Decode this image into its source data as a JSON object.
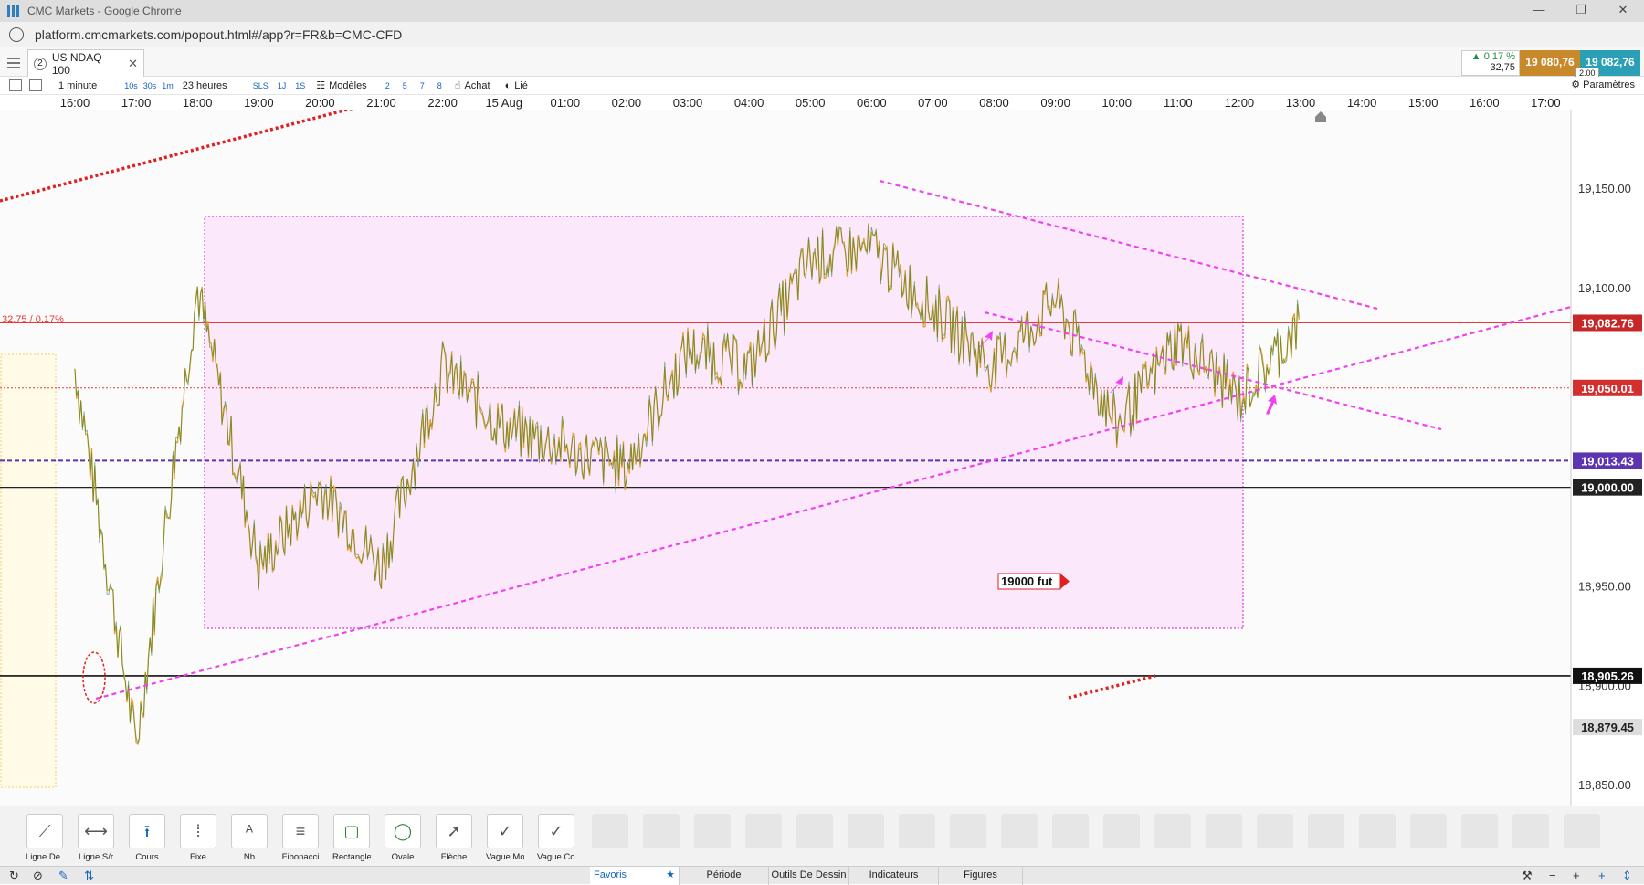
{
  "window": {
    "title": "CMC Markets - Google Chrome",
    "controls": [
      "—",
      "❐",
      "✕"
    ]
  },
  "browser": {
    "url": "platform.cmcmarkets.com/popout.html#/app?r=FR&b=CMC-CFD"
  },
  "instrument": {
    "tab_number": "2",
    "name": "US NDAQ 100",
    "change_pct": "▲ 0,17 %",
    "change_abs": "32,75",
    "sell": "19 080,76",
    "buy": "19 082,76",
    "spread": "2.00"
  },
  "toolbar": {
    "interval": "1 minute",
    "interval_buttons": [
      "10s",
      "30s",
      "1m"
    ],
    "range": "23 heures",
    "range_buttons": [
      "SLS",
      "1J",
      "1S"
    ],
    "templates": "Modèles",
    "template_buttons": [
      "2",
      "5",
      "7",
      "8"
    ],
    "buy_label": "Achat",
    "linked_label": "Lié",
    "settings_label": "Paramètres"
  },
  "time_axis": [
    "16:00",
    "17:00",
    "18:00",
    "19:00",
    "20:00",
    "21:00",
    "22:00",
    "15 Aug",
    "01:00",
    "02:00",
    "03:00",
    "04:00",
    "05:00",
    "06:00",
    "07:00",
    "08:00",
    "09:00",
    "10:00",
    "11:00",
    "12:00",
    "13:00",
    "14:00",
    "15:00",
    "16:00",
    "17:00"
  ],
  "chart_data": {
    "type": "line",
    "ylim": [
      18840,
      19190
    ],
    "y_ticks": [
      "19,150.00",
      "19,100.00",
      "18,950.00",
      "18,900.00",
      "18,850.00"
    ],
    "price_tags": [
      {
        "label": "19,082.76",
        "value": 19082.76,
        "color": "#c62828"
      },
      {
        "label": "19,050.01",
        "value": 19050.01,
        "color": "#d32f2f"
      },
      {
        "label": "19,013.43",
        "value": 19013.43,
        "color": "#5e35b1"
      },
      {
        "label": "19,000.00",
        "value": 19000.0,
        "color": "#222222"
      },
      {
        "label": "18,905.26",
        "value": 18905.26,
        "color": "#111111"
      },
      {
        "label": "18,879.45",
        "value": 18879.45,
        "color": "#dddddd"
      }
    ],
    "change_label": "32.75 / 0.17%",
    "annotation_label": "19000 fut",
    "x": [
      "16:00",
      "17:00",
      "18:00",
      "19:00",
      "20:00",
      "21:00",
      "22:00",
      "15 Aug",
      "01:00",
      "02:00",
      "03:00",
      "04:00",
      "05:00",
      "06:00",
      "07:00",
      "08:00",
      "09:00",
      "10:00",
      "11:00",
      "12:00",
      "13:00"
    ],
    "values": [
      19060,
      18870,
      19100,
      18960,
      19000,
      18960,
      19060,
      19030,
      19020,
      19010,
      19070,
      19060,
      19115,
      19120,
      19090,
      19060,
      19095,
      19030,
      19075,
      19045,
      19082
    ]
  },
  "bottom_tools": [
    "Ligne De ...",
    "Ligne S/r",
    "Cours",
    "Fixe",
    "Nb",
    "Fibonacci",
    "Rectangle",
    "Ovale",
    "Flèche",
    "Vague Mo...",
    "Vague Co..."
  ],
  "bottom_tabs": [
    "Favoris",
    "Période",
    "Outils De Dessin",
    "Indicateurs",
    "Figures"
  ]
}
